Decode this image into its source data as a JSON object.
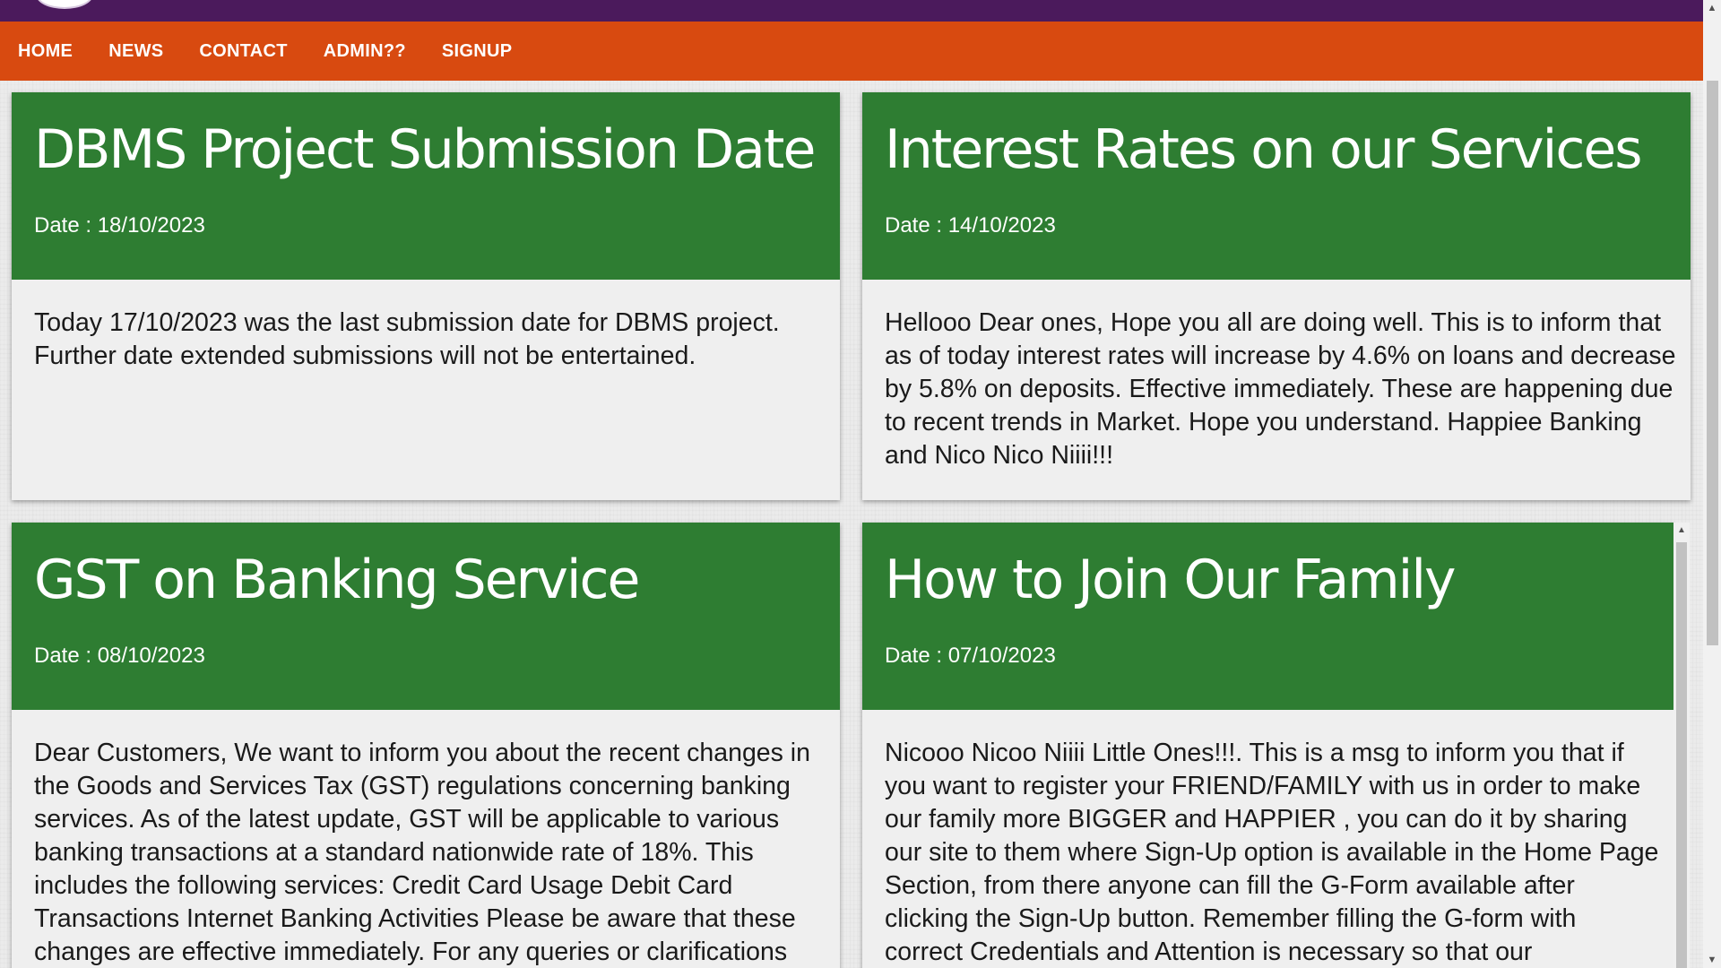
{
  "nav": {
    "items": [
      "HOME",
      "NEWS",
      "CONTACT",
      "ADMIN??",
      "SIGNUP"
    ]
  },
  "news": [
    {
      "title": "DBMS Project Submission Date",
      "date": "Date : 18/10/2023",
      "body": "Today 17/10/2023 was the last submission date for DBMS project. Further date extended submissions will not be entertained."
    },
    {
      "title": "Interest Rates on our Services",
      "date": "Date : 14/10/2023",
      "body": "Hellooo Dear ones, Hope you all are doing well. This is to inform that as of today interest rates will increase by 4.6% on loans and decrease by 5.8% on deposits. Effective immediately. These are happening due to recent trends in Market. Hope you understand. Happiee Banking and Nico Nico Niiii!!!"
    },
    {
      "title": "GST on Banking Service",
      "date": "Date : 08/10/2023",
      "body": "Dear Customers, We want to inform you about the recent changes in the Goods and Services Tax (GST) regulations concerning banking services. As of the latest update, GST will be applicable to various banking transactions at a standard nationwide rate of 18%. This includes the following services: Credit Card Usage Debit Card Transactions Internet Banking Activities Please be aware that these changes are effective immediately. For any queries or clarifications"
    },
    {
      "title": "How to Join Our Family",
      "date": "Date : 07/10/2023",
      "body": "Nicooo Nicoo Niiii Little Ones!!!. This is a msg to inform you that if you want to register your FRIEND/FAMILY with us in order to make our family more BIGGER and HAPPIER , you can do it by sharing our site to them where Sign-Up option is available in the Home Page Section, from there anyone can fill the G-Form available after clicking the Sign-Up button. Remember filling the G-form with correct Credentials and Attention is necessary so that our"
    }
  ],
  "colors": {
    "topbar": "#4b1a5c",
    "navbar": "#d84a10",
    "card_header": "#2e7d32"
  }
}
